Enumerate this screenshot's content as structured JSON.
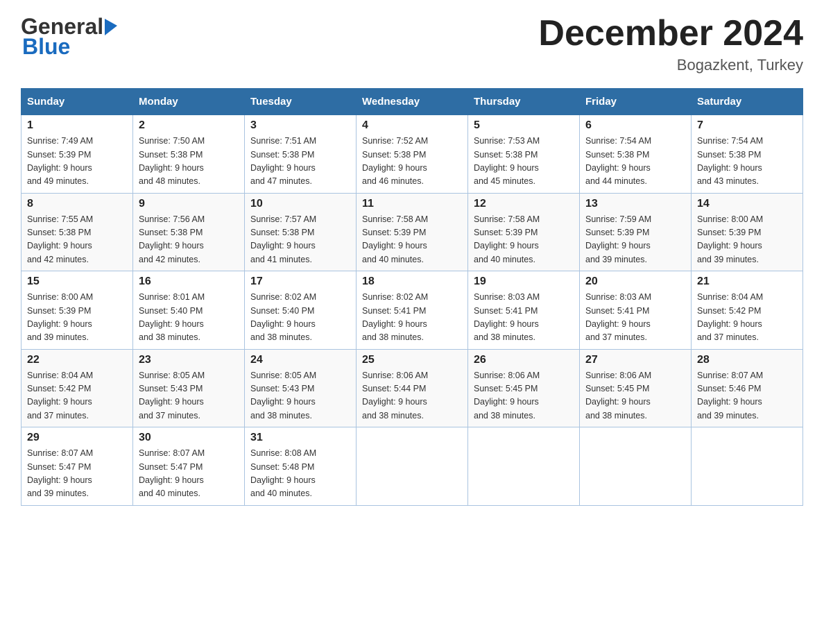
{
  "header": {
    "logo_general": "General",
    "logo_blue": "Blue",
    "month_title": "December 2024",
    "location": "Bogazkent, Turkey"
  },
  "days_of_week": [
    "Sunday",
    "Monday",
    "Tuesday",
    "Wednesday",
    "Thursday",
    "Friday",
    "Saturday"
  ],
  "weeks": [
    [
      {
        "day": "1",
        "sunrise": "Sunrise: 7:49 AM",
        "sunset": "Sunset: 5:39 PM",
        "daylight": "Daylight: 9 hours",
        "daylight2": "and 49 minutes."
      },
      {
        "day": "2",
        "sunrise": "Sunrise: 7:50 AM",
        "sunset": "Sunset: 5:38 PM",
        "daylight": "Daylight: 9 hours",
        "daylight2": "and 48 minutes."
      },
      {
        "day": "3",
        "sunrise": "Sunrise: 7:51 AM",
        "sunset": "Sunset: 5:38 PM",
        "daylight": "Daylight: 9 hours",
        "daylight2": "and 47 minutes."
      },
      {
        "day": "4",
        "sunrise": "Sunrise: 7:52 AM",
        "sunset": "Sunset: 5:38 PM",
        "daylight": "Daylight: 9 hours",
        "daylight2": "and 46 minutes."
      },
      {
        "day": "5",
        "sunrise": "Sunrise: 7:53 AM",
        "sunset": "Sunset: 5:38 PM",
        "daylight": "Daylight: 9 hours",
        "daylight2": "and 45 minutes."
      },
      {
        "day": "6",
        "sunrise": "Sunrise: 7:54 AM",
        "sunset": "Sunset: 5:38 PM",
        "daylight": "Daylight: 9 hours",
        "daylight2": "and 44 minutes."
      },
      {
        "day": "7",
        "sunrise": "Sunrise: 7:54 AM",
        "sunset": "Sunset: 5:38 PM",
        "daylight": "Daylight: 9 hours",
        "daylight2": "and 43 minutes."
      }
    ],
    [
      {
        "day": "8",
        "sunrise": "Sunrise: 7:55 AM",
        "sunset": "Sunset: 5:38 PM",
        "daylight": "Daylight: 9 hours",
        "daylight2": "and 42 minutes."
      },
      {
        "day": "9",
        "sunrise": "Sunrise: 7:56 AM",
        "sunset": "Sunset: 5:38 PM",
        "daylight": "Daylight: 9 hours",
        "daylight2": "and 42 minutes."
      },
      {
        "day": "10",
        "sunrise": "Sunrise: 7:57 AM",
        "sunset": "Sunset: 5:38 PM",
        "daylight": "Daylight: 9 hours",
        "daylight2": "and 41 minutes."
      },
      {
        "day": "11",
        "sunrise": "Sunrise: 7:58 AM",
        "sunset": "Sunset: 5:39 PM",
        "daylight": "Daylight: 9 hours",
        "daylight2": "and 40 minutes."
      },
      {
        "day": "12",
        "sunrise": "Sunrise: 7:58 AM",
        "sunset": "Sunset: 5:39 PM",
        "daylight": "Daylight: 9 hours",
        "daylight2": "and 40 minutes."
      },
      {
        "day": "13",
        "sunrise": "Sunrise: 7:59 AM",
        "sunset": "Sunset: 5:39 PM",
        "daylight": "Daylight: 9 hours",
        "daylight2": "and 39 minutes."
      },
      {
        "day": "14",
        "sunrise": "Sunrise: 8:00 AM",
        "sunset": "Sunset: 5:39 PM",
        "daylight": "Daylight: 9 hours",
        "daylight2": "and 39 minutes."
      }
    ],
    [
      {
        "day": "15",
        "sunrise": "Sunrise: 8:00 AM",
        "sunset": "Sunset: 5:39 PM",
        "daylight": "Daylight: 9 hours",
        "daylight2": "and 39 minutes."
      },
      {
        "day": "16",
        "sunrise": "Sunrise: 8:01 AM",
        "sunset": "Sunset: 5:40 PM",
        "daylight": "Daylight: 9 hours",
        "daylight2": "and 38 minutes."
      },
      {
        "day": "17",
        "sunrise": "Sunrise: 8:02 AM",
        "sunset": "Sunset: 5:40 PM",
        "daylight": "Daylight: 9 hours",
        "daylight2": "and 38 minutes."
      },
      {
        "day": "18",
        "sunrise": "Sunrise: 8:02 AM",
        "sunset": "Sunset: 5:41 PM",
        "daylight": "Daylight: 9 hours",
        "daylight2": "and 38 minutes."
      },
      {
        "day": "19",
        "sunrise": "Sunrise: 8:03 AM",
        "sunset": "Sunset: 5:41 PM",
        "daylight": "Daylight: 9 hours",
        "daylight2": "and 38 minutes."
      },
      {
        "day": "20",
        "sunrise": "Sunrise: 8:03 AM",
        "sunset": "Sunset: 5:41 PM",
        "daylight": "Daylight: 9 hours",
        "daylight2": "and 37 minutes."
      },
      {
        "day": "21",
        "sunrise": "Sunrise: 8:04 AM",
        "sunset": "Sunset: 5:42 PM",
        "daylight": "Daylight: 9 hours",
        "daylight2": "and 37 minutes."
      }
    ],
    [
      {
        "day": "22",
        "sunrise": "Sunrise: 8:04 AM",
        "sunset": "Sunset: 5:42 PM",
        "daylight": "Daylight: 9 hours",
        "daylight2": "and 37 minutes."
      },
      {
        "day": "23",
        "sunrise": "Sunrise: 8:05 AM",
        "sunset": "Sunset: 5:43 PM",
        "daylight": "Daylight: 9 hours",
        "daylight2": "and 37 minutes."
      },
      {
        "day": "24",
        "sunrise": "Sunrise: 8:05 AM",
        "sunset": "Sunset: 5:43 PM",
        "daylight": "Daylight: 9 hours",
        "daylight2": "and 38 minutes."
      },
      {
        "day": "25",
        "sunrise": "Sunrise: 8:06 AM",
        "sunset": "Sunset: 5:44 PM",
        "daylight": "Daylight: 9 hours",
        "daylight2": "and 38 minutes."
      },
      {
        "day": "26",
        "sunrise": "Sunrise: 8:06 AM",
        "sunset": "Sunset: 5:45 PM",
        "daylight": "Daylight: 9 hours",
        "daylight2": "and 38 minutes."
      },
      {
        "day": "27",
        "sunrise": "Sunrise: 8:06 AM",
        "sunset": "Sunset: 5:45 PM",
        "daylight": "Daylight: 9 hours",
        "daylight2": "and 38 minutes."
      },
      {
        "day": "28",
        "sunrise": "Sunrise: 8:07 AM",
        "sunset": "Sunset: 5:46 PM",
        "daylight": "Daylight: 9 hours",
        "daylight2": "and 39 minutes."
      }
    ],
    [
      {
        "day": "29",
        "sunrise": "Sunrise: 8:07 AM",
        "sunset": "Sunset: 5:47 PM",
        "daylight": "Daylight: 9 hours",
        "daylight2": "and 39 minutes."
      },
      {
        "day": "30",
        "sunrise": "Sunrise: 8:07 AM",
        "sunset": "Sunset: 5:47 PM",
        "daylight": "Daylight: 9 hours",
        "daylight2": "and 40 minutes."
      },
      {
        "day": "31",
        "sunrise": "Sunrise: 8:08 AM",
        "sunset": "Sunset: 5:48 PM",
        "daylight": "Daylight: 9 hours",
        "daylight2": "and 40 minutes."
      },
      null,
      null,
      null,
      null
    ]
  ]
}
